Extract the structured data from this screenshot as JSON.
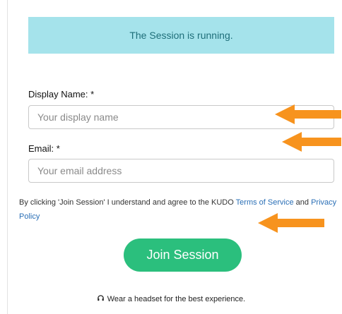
{
  "banner": {
    "text": "The Session is running."
  },
  "form": {
    "display_name_label": "Display Name: *",
    "display_name_placeholder": "Your display name",
    "email_label": "Email: *",
    "email_placeholder": "Your email address"
  },
  "terms": {
    "prefix": "By clicking 'Join Session' I understand and agree to the KUDO ",
    "terms_link": "Terms of Service",
    "middle": " and ",
    "privacy_link": "Privacy Policy"
  },
  "join_button": {
    "label": "Join Session",
    "color": "#2bbf7d"
  },
  "hint": {
    "text": "Wear a headset for the best experience.",
    "icon": "headset-icon"
  },
  "annotations": {
    "arrow_color": "#f7931e",
    "arrow_icon": "arrow-left-icon"
  }
}
